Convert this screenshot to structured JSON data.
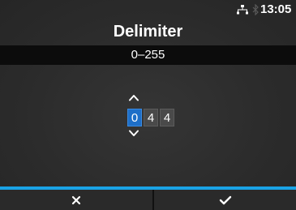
{
  "status": {
    "time": "13:05",
    "network_icon": "network-icon",
    "bluetooth_icon": "bluetooth-icon"
  },
  "screen": {
    "title": "Delimiter",
    "range": "0–255"
  },
  "value_editor": {
    "digits": [
      "0",
      "4",
      "4"
    ],
    "active_digit_index": 0,
    "increase_icon": "chevron-up-icon",
    "decrease_icon": "chevron-down-icon"
  },
  "softkeys": {
    "cancel_icon": "close-icon",
    "confirm_icon": "checkmark-icon"
  },
  "colors": {
    "accent": "#1aa3e6",
    "active_digit": "#1e6fc8",
    "range_bar": "#0c0c0c"
  }
}
